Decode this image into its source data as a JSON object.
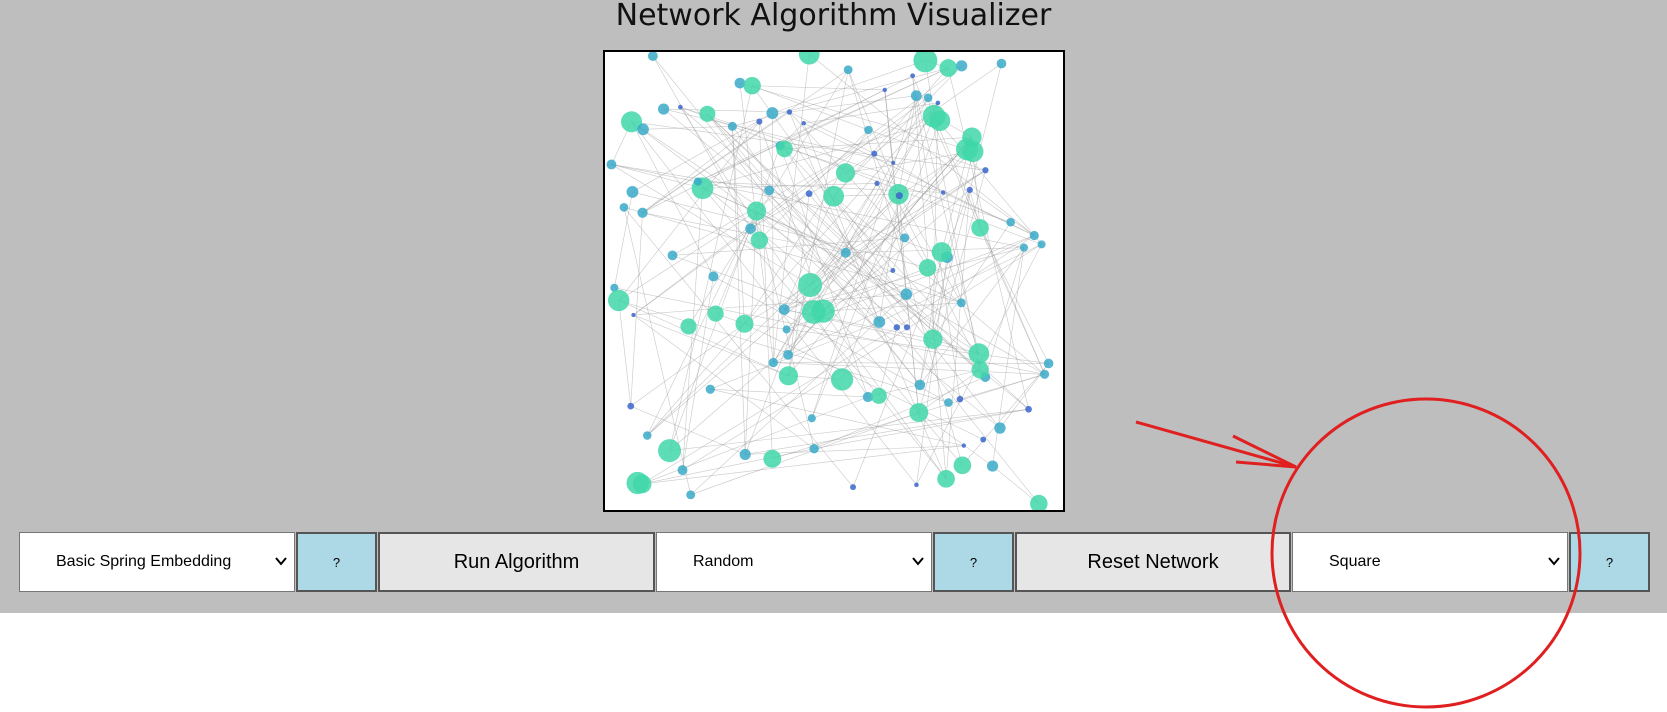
{
  "page": {
    "title": "Network Algorithm Visualizer"
  },
  "controls": {
    "algorithm_select": {
      "value": "Basic Spring Embedding"
    },
    "algorithm_help_label": "?",
    "run_button_label": "Run Algorithm",
    "init_select": {
      "value": "Random"
    },
    "init_help_label": "?",
    "reset_button_label": "Reset Network",
    "shape_select": {
      "value": "Square"
    },
    "shape_help_label": "?"
  },
  "colors": {
    "background": "#bebebe",
    "help_button": "#add8e6",
    "action_button": "#e6e6e6",
    "node_large": "#3fd7a8",
    "node_medium": "#3aaac8",
    "node_small": "#3a66cc",
    "edge": "#9a9a9a",
    "annotation": "#e02020"
  },
  "icons": {
    "select_chevron": "chevron-down-icon"
  }
}
